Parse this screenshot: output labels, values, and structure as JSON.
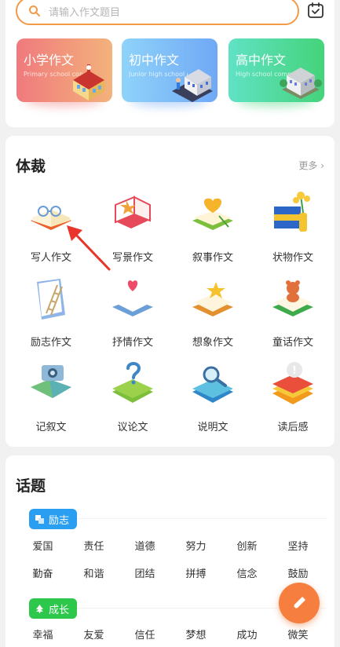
{
  "search": {
    "placeholder": "请输入作文题目"
  },
  "levels": [
    {
      "title": "小学作文",
      "subtitle": "Primary school composition"
    },
    {
      "title": "初中作文",
      "subtitle": "Junior high school composition"
    },
    {
      "title": "高中作文",
      "subtitle": "High school composition"
    }
  ],
  "genre": {
    "title": "体裁",
    "more": "更多",
    "items": [
      {
        "label": "写人作文",
        "icon": "open-book-glasses-icon"
      },
      {
        "label": "写景作文",
        "icon": "book-maple-leaf-icon"
      },
      {
        "label": "叙事作文",
        "icon": "book-heart-balloon-icon"
      },
      {
        "label": "状物作文",
        "icon": "books-flower-vase-icon"
      },
      {
        "label": "励志作文",
        "icon": "book-ladder-icon"
      },
      {
        "label": "抒情作文",
        "icon": "book-heart-icon"
      },
      {
        "label": "想象作文",
        "icon": "book-star-icon"
      },
      {
        "label": "童话作文",
        "icon": "book-teddy-bear-icon"
      },
      {
        "label": "记叙文",
        "icon": "map-camera-icon"
      },
      {
        "label": "议论文",
        "icon": "book-question-mark-icon"
      },
      {
        "label": "说明文",
        "icon": "books-magnifier-icon"
      },
      {
        "label": "读后感",
        "icon": "books-speech-bubble-icon"
      }
    ]
  },
  "topics": {
    "title": "话题",
    "groups": [
      {
        "tag": "励志",
        "color": "#2a9ff2",
        "words": [
          "爱国",
          "责任",
          "道德",
          "努力",
          "创新",
          "坚持",
          "勤奋",
          "和谐",
          "团结",
          "拼搏",
          "信念",
          "鼓励"
        ]
      },
      {
        "tag": "成长",
        "color": "#2dc74b",
        "words": [
          "幸福",
          "友爱",
          "信任",
          "梦想",
          "成功",
          "微笑"
        ]
      }
    ]
  },
  "colors": {
    "accent": "#f19a47",
    "fab": "#f67e3f"
  }
}
